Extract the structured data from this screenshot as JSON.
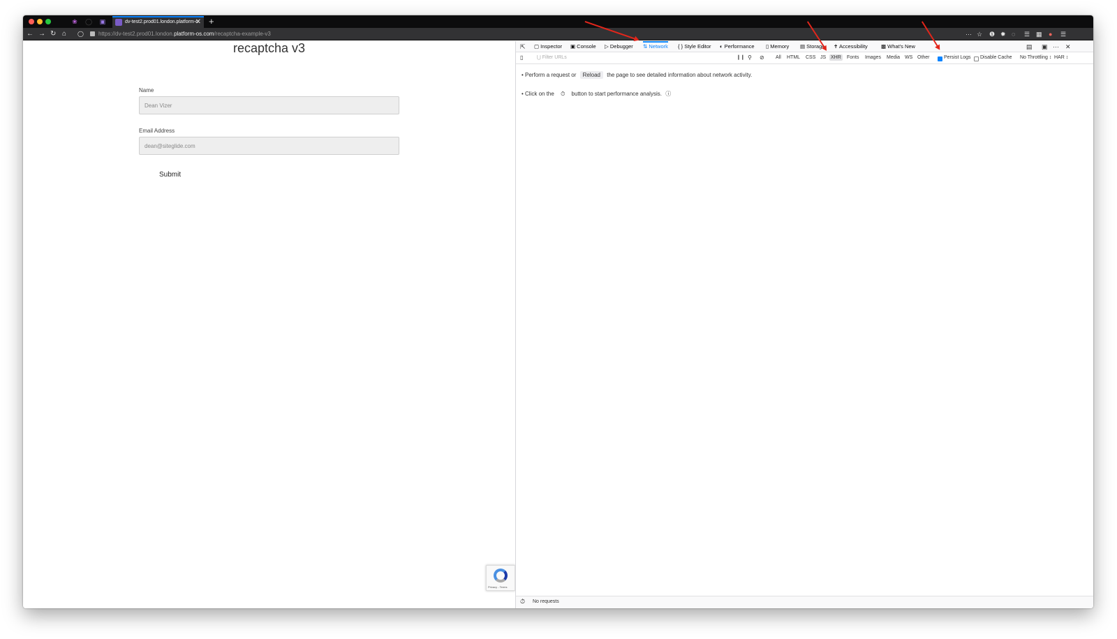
{
  "browser": {
    "tab_title": "dv-test2.prod01.london.platform-o",
    "url_prefix": "https://dv-test2.prod01.london.",
    "url_host": "platform-os.com",
    "url_path": "/recaptcha-example-v3"
  },
  "page": {
    "title": "recaptcha v3",
    "name_label": "Name",
    "name_value": "Dean Vizer",
    "email_label": "Email Address",
    "email_value": "dean@siteglide.com",
    "submit_label": "Submit",
    "recaptcha_terms": "Privacy - Terms"
  },
  "devtools": {
    "tabs": [
      "Inspector",
      "Console",
      "Debugger",
      "Network",
      "Style Editor",
      "Performance",
      "Memory",
      "Storage",
      "Accessibility",
      "What's New"
    ],
    "active_tab": "Network",
    "filter_placeholder": "Filter URLs",
    "filter_types": [
      "All",
      "HTML",
      "CSS",
      "JS",
      "XHR",
      "Fonts",
      "Images",
      "Media",
      "WS",
      "Other"
    ],
    "selected_filter": "XHR",
    "persist_logs": "Persist Logs",
    "disable_cache": "Disable Cache",
    "throttling": "No Throttling ↕",
    "har": "HAR ↕",
    "msg1_a": "• Perform a request or",
    "msg1_btn": "Reload",
    "msg1_b": "the page to see detailed information about network activity.",
    "msg2_a": "• Click on the",
    "msg2_b": "button to start performance analysis.",
    "status": "No requests"
  },
  "colors": {
    "accent": "#0a84ff",
    "annotation": "#e3261b"
  }
}
